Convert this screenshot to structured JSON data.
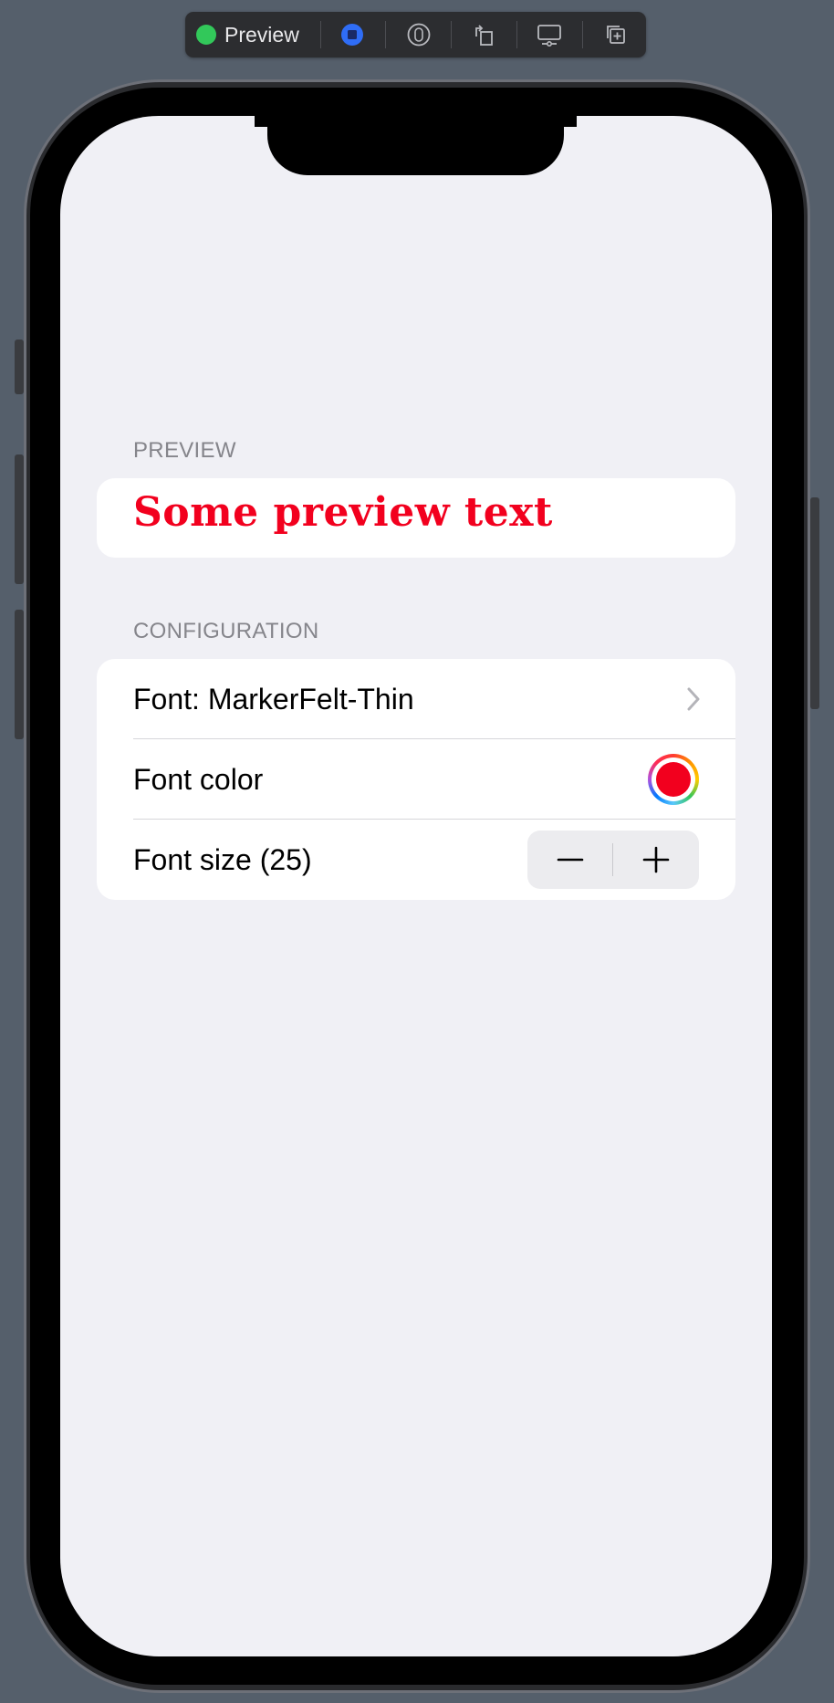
{
  "toolbar": {
    "live_label": "Preview",
    "buttons": [
      "live-preview-icon",
      "selectable-icon",
      "rotate-icon",
      "device-settings-icon",
      "duplicate-icon"
    ]
  },
  "sections": {
    "preview": {
      "header": "PREVIEW",
      "text": "Some preview text",
      "text_color": "#f2001e"
    },
    "configuration": {
      "header": "CONFIGURATION",
      "font_row": "Font: MarkerFelt-Thin",
      "color_row": "Font color",
      "selected_color": "#f2001e",
      "size_row": "Font size (25)"
    }
  }
}
